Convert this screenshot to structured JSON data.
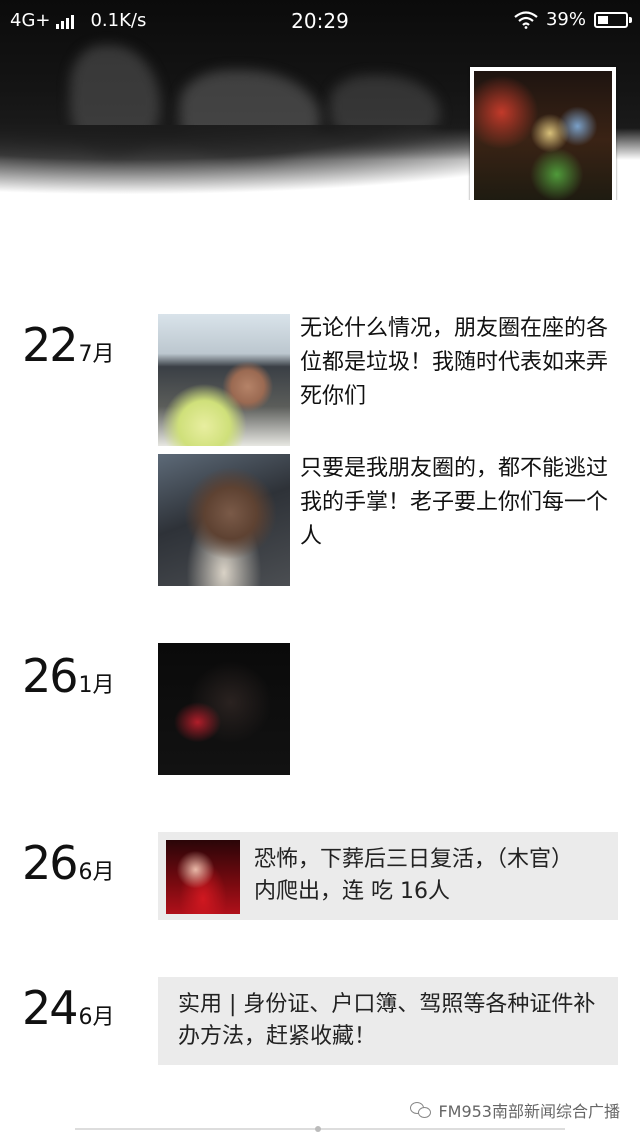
{
  "status_bar": {
    "network": "4G+",
    "speed": "0.1K/s",
    "time": "20:29",
    "battery": "39%",
    "battery_level": 0.39,
    "icons": [
      "signal-icon",
      "wifi-icon",
      "battery-icon"
    ]
  },
  "profile": {
    "avatar": "profile-avatar"
  },
  "timeline": [
    {
      "day": "22",
      "month": "7月",
      "posts": [
        {
          "text": "无论什么情况，朋友圈在座的各位都是垃圾！我随时代表如来弄死你们"
        },
        {
          "text": "只要是我朋友圈的，都不能逃过我的手掌！老子要上你们每一个人"
        }
      ]
    },
    {
      "day": "26",
      "month": "1月",
      "posts": [
        {
          "text": ""
        }
      ]
    },
    {
      "day": "26",
      "month": "6月",
      "share": {
        "text": "恐怖，下葬后三日复活，（木官）内爬出，连 吃 16人"
      }
    },
    {
      "day": "24",
      "month": "6月",
      "share": {
        "text": "实用 | 身份证、户口簿、驾照等各种证件补办方法，赶紧收藏！"
      }
    }
  ],
  "watermark": {
    "text": "FM953南部新闻综合广播"
  }
}
